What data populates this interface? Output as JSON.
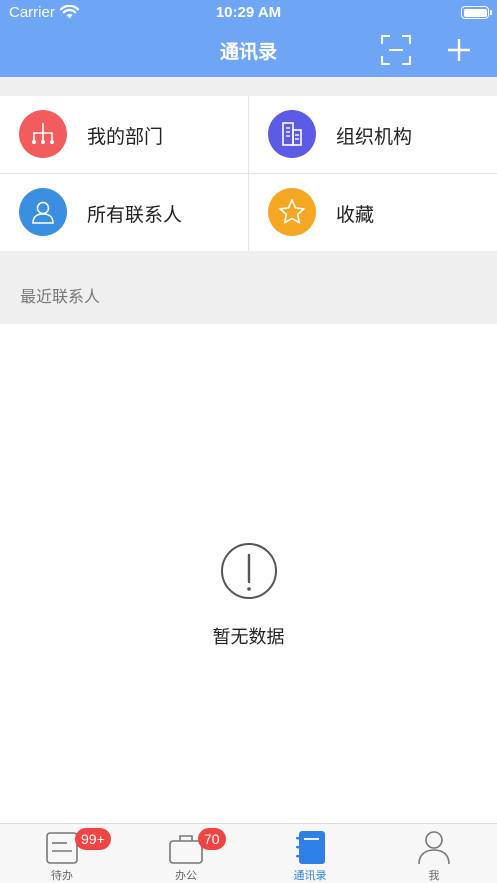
{
  "status_bar": {
    "carrier": "Carrier",
    "time": "10:29 AM"
  },
  "header": {
    "title": "通讯录",
    "scan_icon": "scan-icon",
    "add_icon": "plus-icon"
  },
  "grid": [
    {
      "label": "我的部门",
      "icon": "org-tree-icon",
      "color": "#f25c5c"
    },
    {
      "label": "组织机构",
      "icon": "building-icon",
      "color": "#5b5be6"
    },
    {
      "label": "所有联系人",
      "icon": "person-icon",
      "color": "#3b8fe0"
    },
    {
      "label": "收藏",
      "icon": "star-icon",
      "color": "#f5a623"
    }
  ],
  "recent": {
    "label": "最近联系人"
  },
  "empty": {
    "text": "暂无数据",
    "icon": "exclamation-circle-icon"
  },
  "tabs": [
    {
      "label": "待办",
      "badge": "99+",
      "icon": "todo-icon",
      "active": false
    },
    {
      "label": "办公",
      "badge": "70",
      "icon": "briefcase-icon",
      "active": false
    },
    {
      "label": "通讯录",
      "badge": "",
      "icon": "address-book-icon",
      "active": true
    },
    {
      "label": "我",
      "badge": "",
      "icon": "profile-icon",
      "active": false
    }
  ],
  "colors": {
    "header": "#6ea6f5",
    "active_tab": "#2f7fe8",
    "badge": "#f04343"
  }
}
